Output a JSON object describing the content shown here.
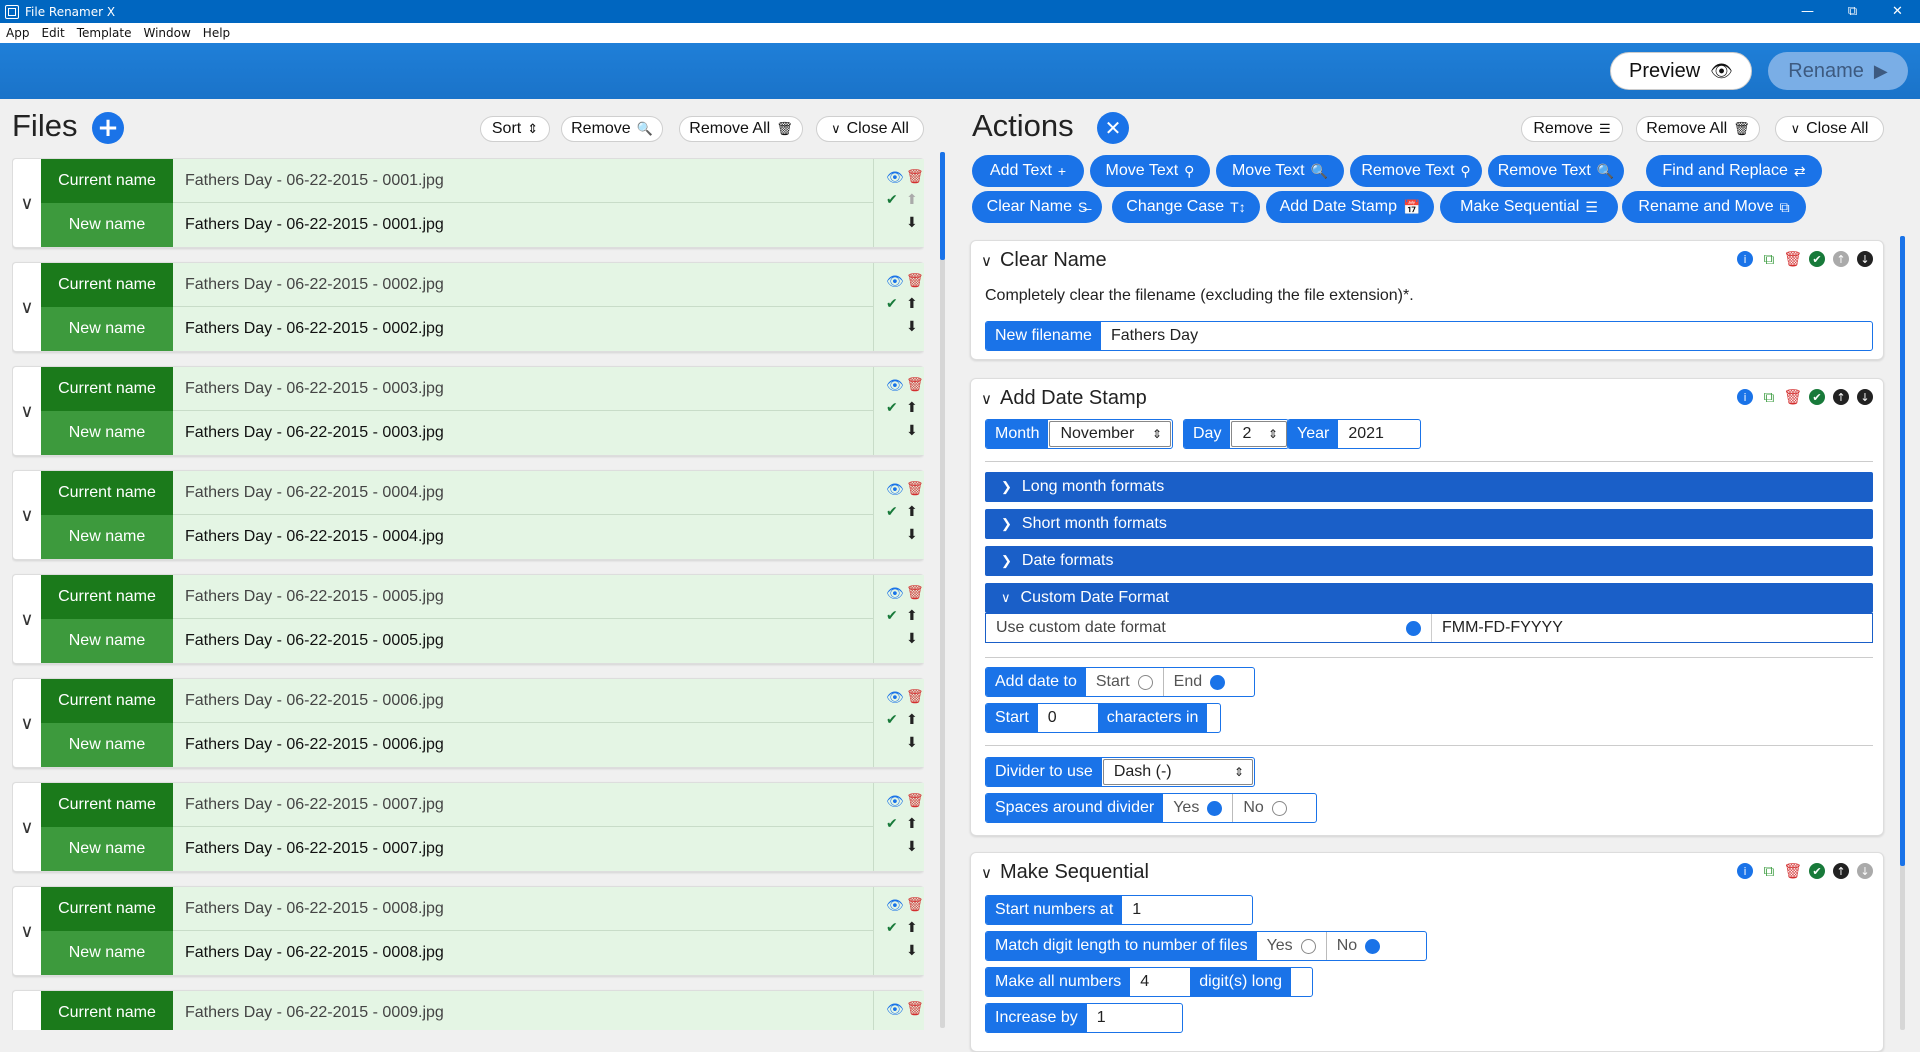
{
  "app": {
    "title": "File Renamer X"
  },
  "menu": [
    "App",
    "Edit",
    "Template",
    "Window",
    "Help"
  ],
  "header": {
    "preview_label": "Preview",
    "rename_label": "Rename"
  },
  "files_panel": {
    "title": "Files",
    "sort_label": "Sort",
    "remove_label": "Remove",
    "remove_all_label": "Remove All",
    "close_all_label": "Close All",
    "current_label": "Current name",
    "new_label": "New name",
    "rows": [
      {
        "current": "Fathers Day - 06-22-2015 - 0001.jpg",
        "new": "Fathers Day - 06-22-2015 - 0001.jpg"
      },
      {
        "current": "Fathers Day - 06-22-2015 - 0002.jpg",
        "new": "Fathers Day - 06-22-2015 - 0002.jpg"
      },
      {
        "current": "Fathers Day - 06-22-2015 - 0003.jpg",
        "new": "Fathers Day - 06-22-2015 - 0003.jpg"
      },
      {
        "current": "Fathers Day - 06-22-2015 - 0004.jpg",
        "new": "Fathers Day - 06-22-2015 - 0004.jpg"
      },
      {
        "current": "Fathers Day - 06-22-2015 - 0005.jpg",
        "new": "Fathers Day - 06-22-2015 - 0005.jpg"
      },
      {
        "current": "Fathers Day - 06-22-2015 - 0006.jpg",
        "new": "Fathers Day - 06-22-2015 - 0006.jpg"
      },
      {
        "current": "Fathers Day - 06-22-2015 - 0007.jpg",
        "new": "Fathers Day - 06-22-2015 - 0007.jpg"
      },
      {
        "current": "Fathers Day - 06-22-2015 - 0008.jpg",
        "new": "Fathers Day - 06-22-2015 - 0008.jpg"
      },
      {
        "current": "Fathers Day - 06-22-2015 - 0009.jpg",
        "new": ""
      }
    ]
  },
  "actions_panel": {
    "title": "Actions",
    "remove_label": "Remove",
    "remove_all_label": "Remove All",
    "close_all_label": "Close All",
    "buttons": [
      "Add Text",
      "Move Text",
      "Move Text",
      "Remove Text",
      "Remove Text",
      "Find and Replace",
      "Clear Name",
      "Change Case",
      "Add Date Stamp",
      "Make Sequential",
      "Rename and Move"
    ],
    "clear_name": {
      "title": "Clear Name",
      "description": "Completely clear the filename (excluding the file extension)*.",
      "new_filename_label": "New filename",
      "new_filename_value": "Fathers Day"
    },
    "date_stamp": {
      "title": "Add Date Stamp",
      "month_label": "Month",
      "month_value": "November",
      "day_label": "Day",
      "day_value": "2",
      "year_label": "Year",
      "year_value": "2021",
      "accordions": [
        "Long month formats",
        "Short month formats",
        "Date formats",
        "Custom Date Format"
      ],
      "custom_label": "Use custom date format",
      "custom_value": "FMM-FD-FYYYY",
      "add_to_label": "Add date to",
      "start_label": "Start",
      "end_label": "End",
      "start_chars_label": "Start",
      "start_chars_value": "0",
      "chars_in_label": "characters in",
      "divider_label": "Divider to use",
      "divider_value": "Dash (-)",
      "spaces_label": "Spaces around divider",
      "yes_label": "Yes",
      "no_label": "No"
    },
    "sequential": {
      "title": "Make Sequential",
      "start_label": "Start numbers at",
      "start_value": "1",
      "match_label": "Match digit length to number of files",
      "yes_label": "Yes",
      "no_label": "No",
      "make_all_label": "Make all numbers",
      "make_all_value": "4",
      "digits_label": "digit(s) long",
      "increase_label": "Increase by",
      "increase_value": "1"
    }
  }
}
